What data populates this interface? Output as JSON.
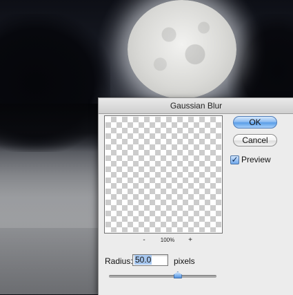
{
  "dialog": {
    "title": "Gaussian Blur",
    "ok_label": "OK",
    "cancel_label": "Cancel",
    "preview_label": "Preview",
    "preview_checked": true,
    "zoom_out_label": "-",
    "zoom_level": "100%",
    "zoom_in_label": "+",
    "radius_label": "Radius:",
    "radius_value": "50.0",
    "units_label": "pixels",
    "slider_fraction": 0.64
  }
}
